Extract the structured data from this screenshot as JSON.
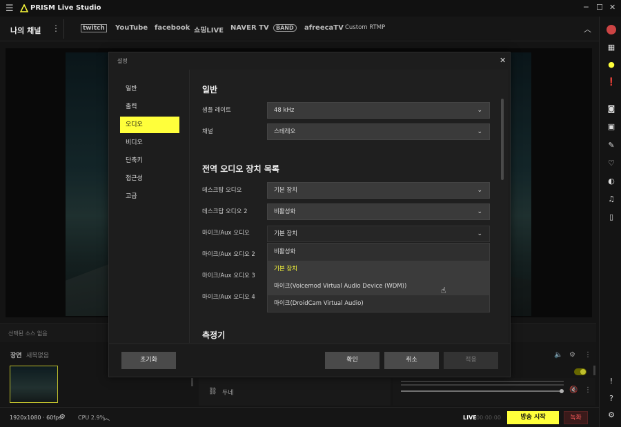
{
  "app": {
    "name": "PRISM Live Studio"
  },
  "channels": {
    "my_channel": "나의 채널",
    "platforms": [
      "twitch",
      "YouTube",
      "facebook",
      "쇼핑LIVE",
      "NAVER TV",
      "BAND",
      "afreecaTV",
      "Custom RTMP"
    ]
  },
  "source_strip": {
    "text": "선택된 소스 없음"
  },
  "scene": {
    "label": "장면",
    "name": "새목없음"
  },
  "source_item": {
    "name": "두네"
  },
  "status": {
    "resolution": "1920x1080 · 60fps",
    "cpu": "CPU 2.9%",
    "live": "LIVE",
    "time": "00:00:00",
    "go_live": "방송 시작",
    "record": "녹화"
  },
  "dialog": {
    "title": "설정",
    "nav": [
      "일반",
      "출력",
      "오디오",
      "비디오",
      "단축키",
      "접근성",
      "고급"
    ],
    "active_nav": "오디오",
    "general_section": "일반",
    "sample_rate_label": "샘플 레이트",
    "sample_rate_value": "48 kHz",
    "channel_label": "채널",
    "channel_value": "스테레오",
    "devices_section": "전역 오디오 장치 목록",
    "desktop_audio_label": "데스크탑 오디오",
    "desktop_audio_value": "기본 장치",
    "desktop_audio2_label": "데스크탑 오디오 2",
    "desktop_audio2_value": "비활성화",
    "mic_label": "마이크/Aux 오디오",
    "mic_value": "기본 장치",
    "mic2_label": "마이크/Aux 오디오 2",
    "mic3_label": "마이크/Aux 오디오 3",
    "mic4_label": "마이크/Aux 오디오 4",
    "dropdown_options": [
      "비활성화",
      "기본 장치",
      "마이크(Voicemod Virtual Audio Device (WDM))",
      "마이크(DroidCam Virtual Audio)"
    ],
    "meter_section": "측정기",
    "reset": "초기화",
    "ok": "확인",
    "cancel": "취소",
    "apply": "적용"
  },
  "colors": {
    "accent": "#ffff3b",
    "background": "#1b1b1b",
    "record": "#ff5a5a"
  }
}
